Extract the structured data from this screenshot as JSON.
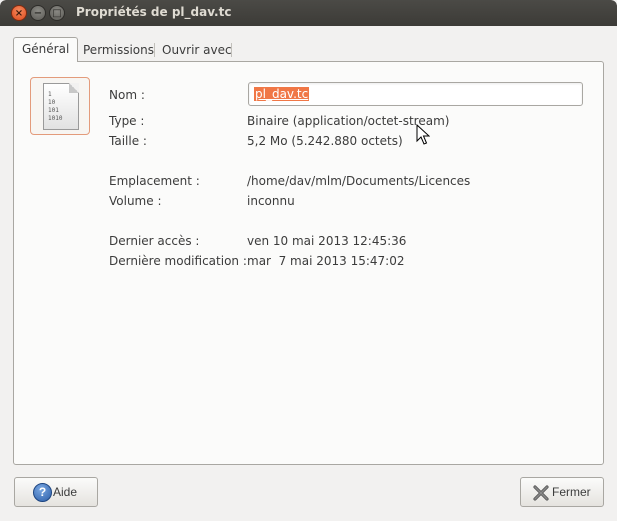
{
  "window": {
    "title": "Propriétés de pl_dav.tc",
    "close_glyph": "×",
    "min_glyph": "−",
    "max_glyph": "□"
  },
  "tabs": [
    {
      "label": "Général",
      "active": true
    },
    {
      "label": "Permissions",
      "active": false
    },
    {
      "label": "Ouvrir avec",
      "active": false
    }
  ],
  "file_icon": {
    "name": "binary-file-icon",
    "lines": [
      "1",
      "10",
      "101",
      "1010"
    ]
  },
  "fields": {
    "name_label": "Nom :",
    "name_value": "pl_dav.tc",
    "type_label": "Type :",
    "type_value": "Binaire (application/octet-stream)",
    "size_label": "Taille :",
    "size_value": "5,2 Mo (5.242.880 octets)",
    "location_label": "Emplacement :",
    "location_value": "/home/dav/mlm/Documents/Licences",
    "volume_label": "Volume :",
    "volume_value": "inconnu",
    "access_label": "Dernier accès :",
    "access_value": "ven 10 mai 2013 12:45:36",
    "modified_label": "Dernière modification :",
    "modified_value": "mar  7 mai 2013 15:47:02"
  },
  "buttons": {
    "help_label": "Aide",
    "help_glyph": "?",
    "close_label": "Fermer"
  },
  "colors": {
    "accent": "#f07746",
    "titlebar": "#3c3b37"
  }
}
